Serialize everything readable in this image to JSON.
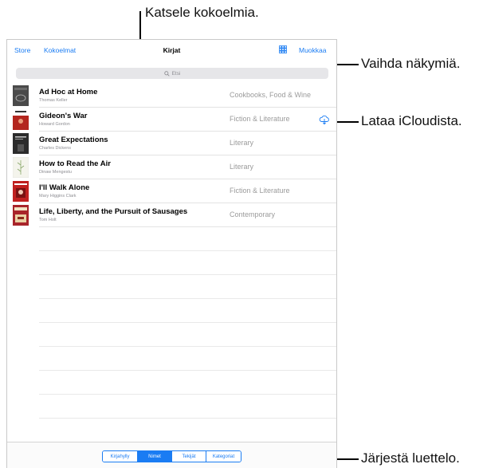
{
  "callouts": {
    "collections": "Katsele kokoelmia.",
    "switch_view": "Vaihda näkymiä.",
    "icloud": "Lataa iCloudista.",
    "sort": "Järjestä luettelo."
  },
  "navbar": {
    "store": "Store",
    "collections": "Kokoelmat",
    "title": "Kirjat",
    "edit": "Muokkaa"
  },
  "search": {
    "placeholder": "Etsi",
    "icon": "search-icon"
  },
  "books": [
    {
      "title": "Ad Hoc at Home",
      "author": "Thomas Keller",
      "category": "Cookbooks, Food & Wine",
      "cover_color": "#4a4a4a"
    },
    {
      "title": "Gideon's War",
      "author": "Howard Gordon",
      "category": "Fiction & Literature",
      "cover_color": "#b3261e",
      "icon": "icloud-download-icon"
    },
    {
      "title": "Great Expectations",
      "author": "Charles Dickens",
      "category": "Literary",
      "cover_color": "#2c2c2c"
    },
    {
      "title": "How to Read the Air",
      "author": "Dinaw Mengestu",
      "category": "Literary",
      "cover_color": "#dfe6c9"
    },
    {
      "title": "I'll Walk Alone",
      "author": "Mary Higgins Clark",
      "category": "Fiction & Literature",
      "cover_color": "#c0201f"
    },
    {
      "title": "Life, Liberty, and the Pursuit of Sausages",
      "author": "Tom Holt",
      "category": "Contemporary",
      "cover_color": "#a8242a"
    }
  ],
  "sort_segments": [
    {
      "label": "Kirjahylly",
      "selected": false
    },
    {
      "label": "Nimet",
      "selected": true
    },
    {
      "label": "Tekijät",
      "selected": false
    },
    {
      "label": "Kategoriat",
      "selected": false
    }
  ],
  "colors": {
    "accent": "#1a7cf3"
  }
}
